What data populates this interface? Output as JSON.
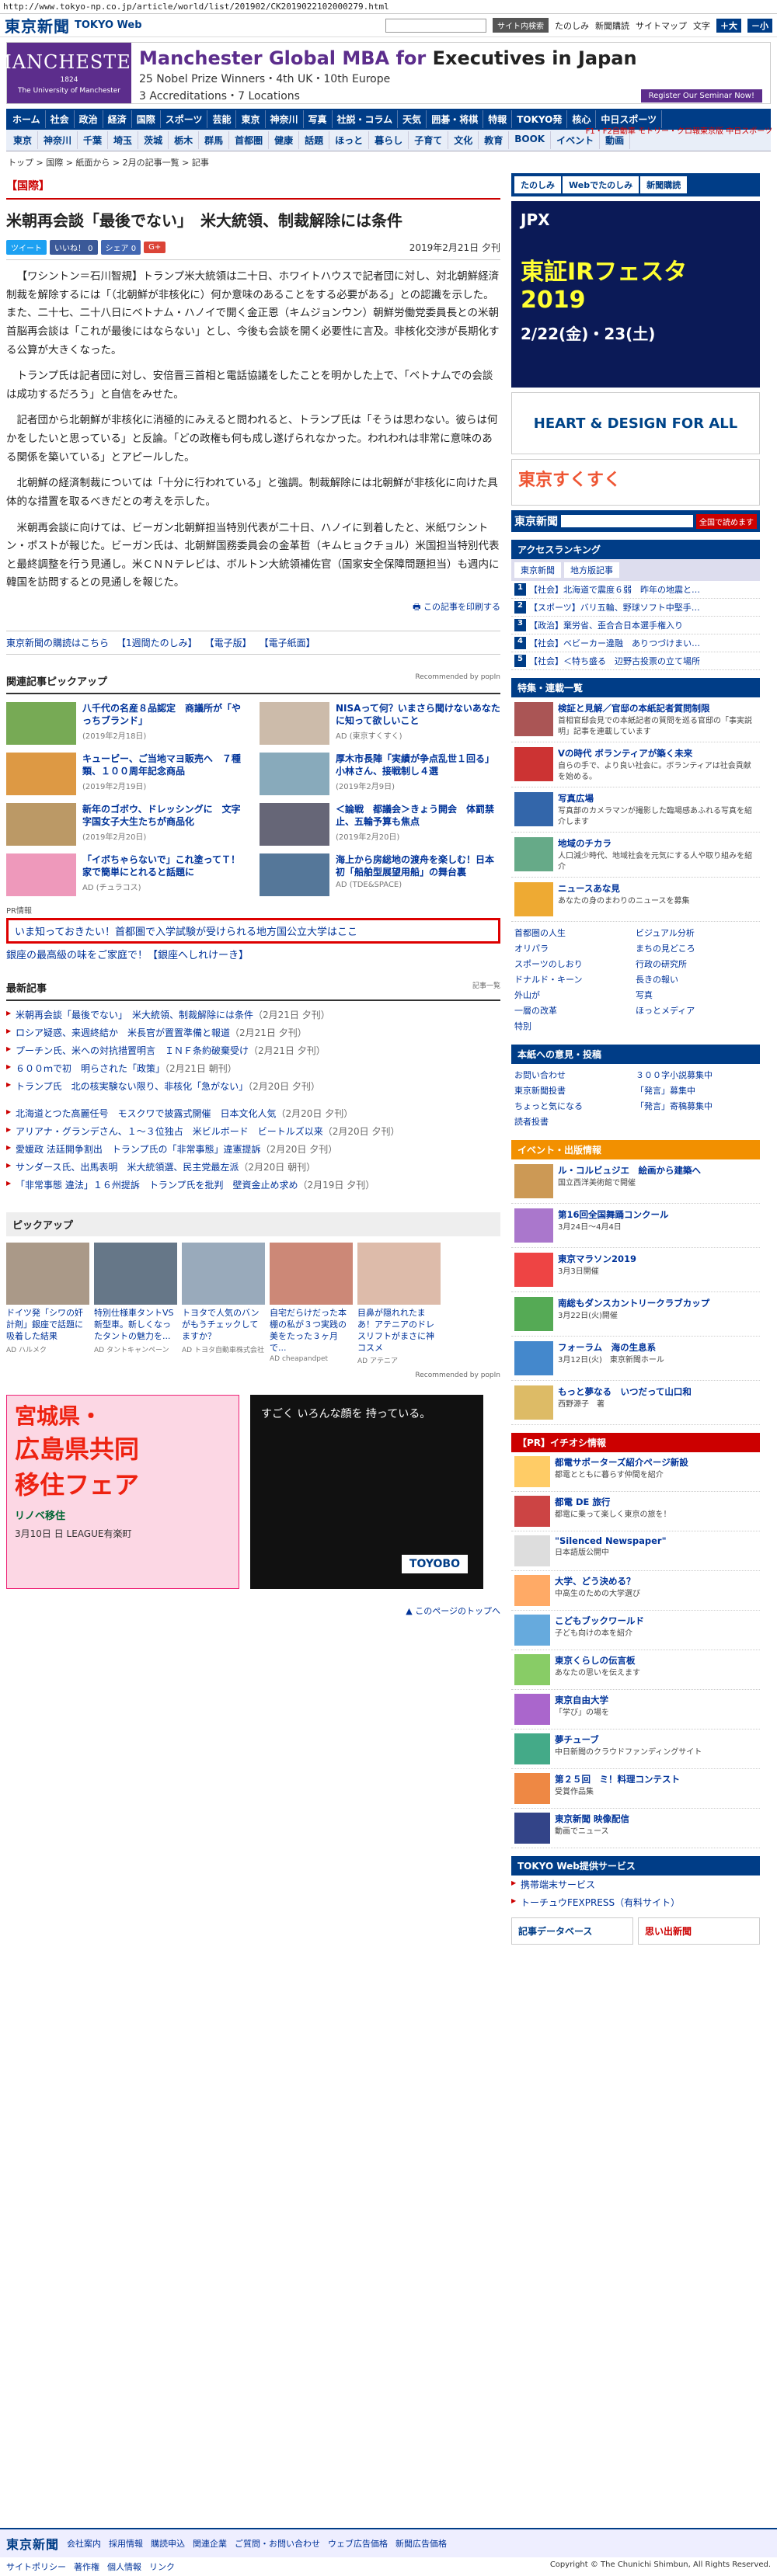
{
  "url": "http://www.tokyo-np.co.jp/article/world/list/201902/CK2019022102000279.html",
  "header": {
    "logo": "東京新聞",
    "logo_sub": "TOKYO Web",
    "search_btn": "サイト内検索",
    "links": [
      "たのしみ",
      "新聞購読",
      "サイトマップ",
      "文字"
    ],
    "font_btn": "＋大",
    "font_btn2": "－小"
  },
  "banner": {
    "school_big": "MANCHESTER",
    "school_year": "1824",
    "school_sub": "The University of Manchester",
    "title_a": "Manchester Global MBA for ",
    "title_b": "Executives in Japan",
    "line1": "25 Nobel Prize Winners・4th UK・10th Europe",
    "line2": "3 Accreditations・7 Locations",
    "cta": "Register Our Seminar Now!"
  },
  "corner_ad": "F1・F2自動車 モトリー・クロ報東京版 中日スポーツ",
  "nav1": [
    "ホーム",
    "社会",
    "政治",
    "経済",
    "国際",
    "スポーツ",
    "芸能",
    "東京",
    "神奈川",
    "写真",
    "社説・コラム",
    "天気",
    "囲碁・将棋",
    "特報",
    "TOKYO発",
    "核心",
    "中日スポーツ"
  ],
  "nav2": [
    "東京",
    "神奈川",
    "千葉",
    "埼玉",
    "茨城",
    "栃木",
    "群馬",
    "首都圏",
    "健康",
    "話題",
    "ほっと",
    "暮らし",
    "子育て",
    "文化",
    "教育",
    "BOOK",
    "イベント",
    "動画"
  ],
  "breadcrumb": "トップ > 国際 > 紙面から > 2月の記事一覧 > 記事",
  "article": {
    "category": "【国際】",
    "headline": "米朝再会談「最後でない」　米大統領、制裁解除には条件",
    "social": [
      "ツイート",
      "いいね！ 0",
      "シェア 0",
      "G+"
    ],
    "date": "2019年2月21日 夕刊",
    "paragraphs": [
      "【ワシントン＝石川智規】トランプ米大統領は二十日、ホワイトハウスで記者団に対し、対北朝鮮経済制裁を解除するには「（北朝鮮が非核化に）何か意味のあることをする必要がある」との認識を示した。また、二十七、二十八日にベトナム・ハノイで開く金正恩（キムジョンウン）朝鮮労働党委員長との米朝首脳再会談は「これが最後にはならない」とし、今後も会談を開く必要性に言及。非核化交渉が長期化する公算が大きくなった。",
      "トランプ氏は記者団に対し、安倍晋三首相と電話協議をしたことを明かした上で、「ベトナムでの会談は成功するだろう」と自信をみせた。",
      "記者団から北朝鮮が非核化に消極的にみえると問われると、トランプ氏は「そうは思わない。彼らは何かをしたいと思っている」と反論。「どの政権も何も成し遂げられなかった。われわれは非常に意味のある関係を築いている」とアピールした。",
      "北朝鮮の経済制裁については「十分に行われている」と強調。制裁解除には北朝鮮が非核化に向けた具体的な措置を取るべきだとの考えを示した。",
      "米朝再会談に向けては、ビーガン北朝鮮担当特別代表が二十日、ハノイに到着したと、米紙ワシントン・ポストが報じた。ビーガン氏は、北朝鮮国務委員会の金革哲（キムヒョクチョル）米国担当特別代表と最終調整を行う見通し。米ＣＮＮテレビは、ボルトン大統領補佐官（国家安全保障問題担当）も週内に韓国を訪問するとの見通しを報じた。"
    ],
    "print": "この記事を印刷する"
  },
  "links_row": [
    "東京新聞の購読はこちら",
    "【1週間たのしみ】",
    "【電子版】",
    "【電子紙面】"
  ],
  "related": {
    "title": "関連記事ピックアップ",
    "rec": "Recommended by popIn",
    "items": [
      {
        "t": "八千代の名産８品認定　商議所が「やっちブランド」",
        "d": "(2019年2月18日)"
      },
      {
        "t": "NISAって何？いまさら聞けないあなたに知って欲しいこと",
        "d": "AD (東京すくすく)"
      },
      {
        "t": "キューピー、ご当地マヨ販売へ　７種類、１００周年記念商品",
        "d": "(2019年2月19日)"
      },
      {
        "t": "厚木市長陣「実績が争点乱世１回る」小林さん、接戦制し４選",
        "d": "(2019年2月9日)"
      },
      {
        "t": "新年のゴボウ、ドレッシングに　文字字国女子大生たちが商品化",
        "d": "(2019年2月20日)"
      },
      {
        "t": "＜論戦　都議会＞きょう開会　体罰禁止、五輪予算も焦点",
        "d": "(2019年2月20日)"
      },
      {
        "t": "「イボちゃらないで」これ塗ってＴ！家で簡単にとれると話題に",
        "d": "AD (チュラコス)"
      },
      {
        "t": "海上から房総地の渡舟を楽しむ！日本初「船舶型展望用船」の舞台裏",
        "d": "AD (TDE&SPACE)"
      }
    ]
  },
  "pr": {
    "label": "PR情報",
    "boxed": "いま知っておきたい！首都圏で入学試験が受けられる地方国公立大学はここ",
    "line": "銀座の最高級の味をご家庭で！【銀座へしれけーき】"
  },
  "latest": {
    "title": "最新記事",
    "btn": "記事一覧",
    "items": [
      {
        "t": "米朝再会談「最後でない」　米大統領、制裁解除には条件",
        "d": "（2月21日 夕刊）"
      },
      {
        "t": "ロシア疑惑、来週終結か　米長官が置置準備と報道",
        "d": "（2月21日 夕刊）"
      },
      {
        "t": "プーチン氏、米への対抗措置明言　ＩＮＦ条約破棄受け",
        "d": "（2月21日 夕刊）"
      },
      {
        "t": "６００ｍで初　明らされた「政策」",
        "d": "（2月21日 朝刊）"
      },
      {
        "t": "トランプ氏　北の核実験ない限り、非核化「急がない」",
        "d": "（2月20日 夕刊）"
      }
    ],
    "items2": [
      {
        "t": "北海道とつた高麗任号　モスクワで披露式開催　日本文化人気",
        "d": "（2月20日 夕刊）"
      },
      {
        "t": "アリアナ・グランデさん、１〜３位独占　米ビルボード　ビートルズ以来",
        "d": "（2月20日 夕刊）"
      },
      {
        "t": "愛媛政 法廷開争割出　トランプ氏の「非常事態」違憲提訴",
        "d": "（2月20日 夕刊）"
      },
      {
        "t": "サンダース氏、出馬表明　米大統領選、民主党最左派",
        "d": "（2月20日 朝刊）"
      },
      {
        "t": "「非常事態 違法」１６州提訴　トランプ氏を批判　壁資金止め求め",
        "d": "（2月19日 夕刊）"
      }
    ]
  },
  "pickup": {
    "title": "ピックアップ",
    "items": [
      {
        "t": "ドイツ発「シワの奸計剤」銀座で話題に吸着した結果",
        "s": "AD ハルメク"
      },
      {
        "t": "特別仕様車タントVS新型車。新しくなったタントの魅力を...",
        "s": "AD タントキャンペーン"
      },
      {
        "t": "トヨタで人気のバンがもうチェックしてますか？",
        "s": "AD トヨタ自動車株式会社"
      },
      {
        "t": "自宅だらけだった本棚の私が３つ実践の美をたった３ヶ月で...",
        "s": "AD cheapandpet"
      },
      {
        "t": "目鼻が隠れれたまあ！アテニアのドレスリフトがまさに神コスメ",
        "s": "AD アテニア"
      }
    ],
    "rec": "Recommended by popIn"
  },
  "ads": {
    "fair_l1": "宮城県・",
    "fair_l2": "広島県共同",
    "fair_l3": "移住フェア",
    "fair_sub": "リノベ移住",
    "fair_date": "3月10日 日 LEAGUE有楽町",
    "toyobo_text": "すごく いろんな顔を 持っている。",
    "toyobo_logo": "TOYOBO"
  },
  "pagetop": "このページのトップへ",
  "side": {
    "tabs": [
      "たのしみ",
      "Webでたのしみ",
      "新聞購読"
    ],
    "jpx_t": "JPX",
    "jpx_big": "東証IRフェスタ2019",
    "jpx_date": "2/22(金)・23(土)",
    "heart": "HEART & DESIGN FOR ALL",
    "sukusuku": "東京すくすく",
    "tk_logo": "東京新聞",
    "tk_btn": "全国で読めます",
    "access": "アクセスランキング",
    "rank_tabs": [
      "東京新聞",
      "地方版記事"
    ],
    "rank": [
      "【社会】北海道で震度６弱　昨年の地震と…",
      "【スポーツ】バリ五輪、野球ソフト中堅手…",
      "【政治】棄労省、歪合合日本選手権入り",
      "【社会】ベビーカー違融　ありつづけまい…",
      "【社会】＜特ち盛る　辺野古投票の立て場所"
    ],
    "feature_h": "特集・連載一覧",
    "features": [
      {
        "t": "検証と見解／官邸の本紙記者質問制限",
        "d": "首相官邸会見での本紙記者の質問を巡る官邸の「事実説明」記事を連載しています"
      },
      {
        "t": "Vの時代 ボランティアが築く未来",
        "d": "自らの手で、より良い社会に。ボランティアは社会貢献を始める。"
      },
      {
        "t": "写真広場",
        "d": "写真部のカメラマンが撮影した臨場感あふれる写真を紹介します"
      },
      {
        "t": "地域のチカラ",
        "d": "人口減少時代、地域社会を元気にする人や取り組みを紹介"
      },
      {
        "t": "ニュースあな見",
        "d": "あなたの身のまわりのニュースを募集"
      }
    ],
    "links": [
      "首都圏の人生",
      "ビジュアル分析",
      "オリパラ",
      "まちの見どころ",
      "スポーツのしおり",
      "行政の研究所",
      "ドナルド・キーン",
      "長きの報い",
      "外山が"
    ],
    "links2": [
      "写真",
      "一層の改革",
      "ほっとメディア",
      "特別"
    ],
    "reader_h": "本紙への意見・投稿",
    "reader": [
      "お問い合わせ",
      "東京新聞投書",
      "ちょっと気になる",
      "読者投書",
      "３００字小説募集中",
      "「発言」募集中",
      "「発言」寄稿募集中"
    ],
    "event_h": "イベント・出版情報",
    "events": [
      {
        "t": "ル・コルビュジエ　絵画から建築へ",
        "d": "国立西洋美術館で開催"
      },
      {
        "t": "第16回全国舞踊コンクール",
        "d": "3月24日〜4月4日"
      },
      {
        "t": "東京マラソン2019",
        "d": "3月3日開催"
      },
      {
        "t": "南総もダンスカントリークラブカップ",
        "d": "3月22日(火)開催"
      },
      {
        "t": "フォーラム　海の生息系",
        "d": "3月12日(火)　東京新聞ホール"
      },
      {
        "t": "もっと夢なる　いつだって山口和",
        "d": "西野源子　著"
      }
    ],
    "pr_h": "【PR】イチオシ情報",
    "pr": [
      {
        "t": "都電サポーターズ紹介ページ新設",
        "d": "都電とともに暮らす仲間を紹介"
      },
      {
        "t": "都電 DE 旅行",
        "d": "都電に乗って楽しく東京の旅を！"
      },
      {
        "t": "\"Silenced Newspaper\"",
        "d": "日本語版公開中"
      },
      {
        "t": "大学、どう決める？",
        "d": "中高生のための大学選び"
      },
      {
        "t": "こどもブックワールド",
        "d": "子ども向けの本を紹介"
      },
      {
        "t": "東京くらしの伝言板",
        "d": "あなたの思いを伝えます"
      },
      {
        "t": "東京自由大学",
        "d": "「学び」の場を"
      },
      {
        "t": "夢チューブ",
        "d": "中日新聞のクラウドファンディングサイト"
      },
      {
        "t": "第２５回　ミ！料理コンテスト",
        "d": "受賞作品集"
      },
      {
        "t": "東京新聞 映像配信",
        "d": "動画でニュース"
      }
    ],
    "tokyo_web_h": "TOKYO Web提供サービス",
    "tokyo_web": [
      "携帯端末サービス",
      "トーチュウFEXPRESS（有料サイト）"
    ],
    "db": "記事データベース",
    "sign": "思い出新聞"
  },
  "footer": {
    "logo": "東京新聞",
    "links": [
      "会社案内",
      "採用情報",
      "購読申込",
      "関連企業",
      "ご質問・お問い合わせ",
      "ウェブ広告価格",
      "新聞広告価格"
    ],
    "links2": [
      "サイトポリシー",
      "著作権",
      "個人情報",
      "リンク"
    ],
    "copy": "Copyright © The Chunichi Shimbun, All Rights Reserved."
  },
  "colors": {
    "brand": "#003d87",
    "accent": "#cc0000",
    "mba": "#5c2d8c"
  }
}
